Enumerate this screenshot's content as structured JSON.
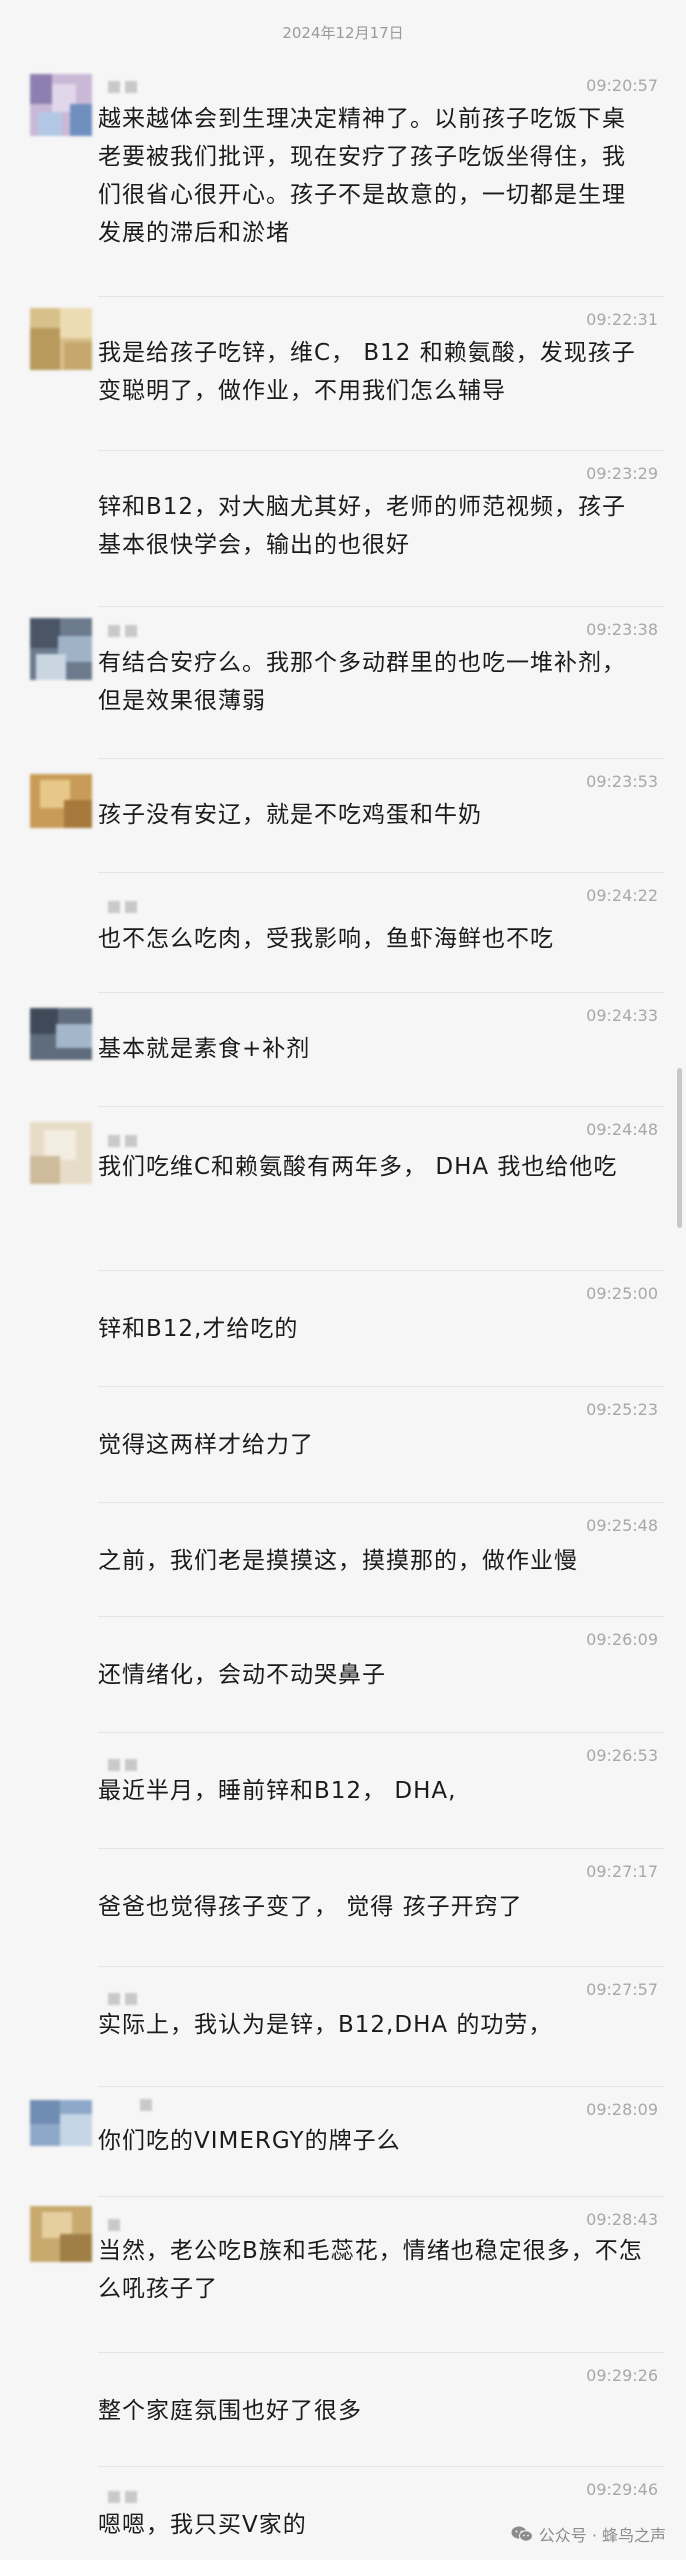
{
  "chat": {
    "date": "2024年12月17日",
    "messages": [
      {
        "time": "09:20:57",
        "text": "越来越体会到生理决定精神了。以前孩子吃饭下桌老要被我们批评，现在安疗了孩子吃饭坐得住，我们很省心很开心。孩子不是故意的，一切都是生理发展的滞后和淤堵"
      },
      {
        "time": "09:22:31",
        "text": "我是给孩子吃锌，维C， B12  和赖氨酸，发现孩子变聪明了，做作业，不用我们怎么辅导"
      },
      {
        "time": "09:23:29",
        "text": "锌和B12，对大脑尤其好，老师的师范视频，孩子基本很快学会，输出的也很好"
      },
      {
        "time": "09:23:38",
        "text": "有结合安疗么。我那个多动群里的也吃一堆补剂，但是效果很薄弱"
      },
      {
        "time": "09:23:53",
        "text": "孩子没有安辽，就是不吃鸡蛋和牛奶"
      },
      {
        "time": "09:24:22",
        "text": "也不怎么吃肉，受我影响，鱼虾海鲜也不吃"
      },
      {
        "time": "09:24:33",
        "text": "基本就是素食+补剂"
      },
      {
        "time": "09:24:48",
        "text": "我们吃维C和赖氨酸有两年多， DHA 我也给他吃"
      },
      {
        "time": "09:25:00",
        "text": "锌和B12,才给吃的"
      },
      {
        "time": "09:25:23",
        "text": "觉得这两样才给力了"
      },
      {
        "time": "09:25:48",
        "text": "之前，我们老是摸摸这，摸摸那的，做作业慢"
      },
      {
        "time": "09:26:09",
        "text": "还情绪化，会动不动哭鼻子"
      },
      {
        "time": "09:26:53",
        "text": "最近半月，睡前锌和B12， DHA,"
      },
      {
        "time": "09:27:17",
        "text": "爸爸也觉得孩子变了， 觉得 孩子开窍了"
      },
      {
        "time": "09:27:57",
        "text": "实际上，我认为是锌，B12,DHA 的功劳，"
      },
      {
        "time": "09:28:09",
        "text": "你们吃的VIMERGY的牌子么"
      },
      {
        "time": "09:28:43",
        "text": "当然，老公吃B族和毛蕊花，情绪也稳定很多，不怎么吼孩子了"
      },
      {
        "time": "09:29:26",
        "text": "整个家庭氛围也好了很多"
      },
      {
        "time": "09:29:46",
        "text": "嗯嗯，我只买V家的"
      }
    ]
  },
  "watermark": {
    "text": "公众号 · 蜂鸟之声",
    "icon": "wechat-icon"
  },
  "colors": {
    "background": "#f6f6f6",
    "text": "#1b1b1b",
    "time": "#a8a8a8"
  }
}
